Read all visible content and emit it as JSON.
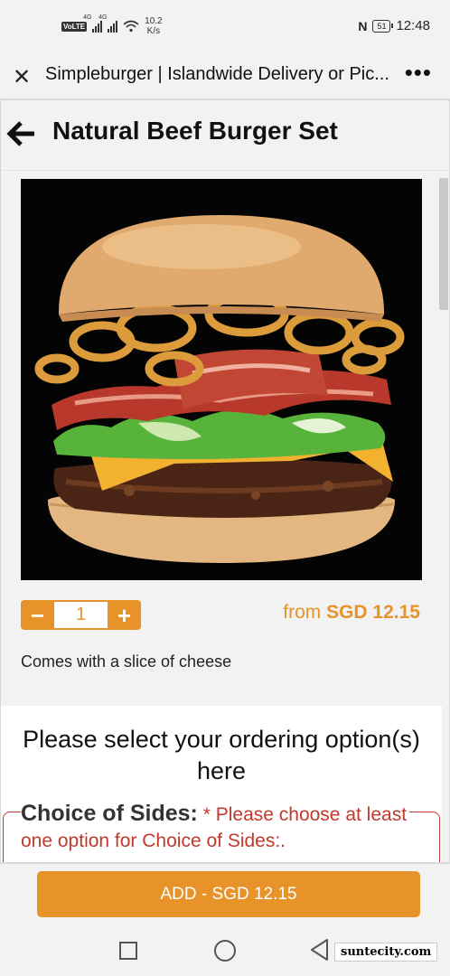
{
  "status_bar": {
    "volte": "VoLTE",
    "network_1": "4G",
    "network_2": "4G",
    "speed_value": "10.2",
    "speed_unit": "K/s",
    "battery": "51",
    "time": "12:48"
  },
  "browser": {
    "title": "Simpleburger | Islandwide Delivery or Pic...",
    "close_icon": "close-icon",
    "more_icon": "more-vert-icon"
  },
  "page": {
    "title": "Natural Beef Burger Set",
    "back_icon": "arrow-left-icon"
  },
  "product": {
    "image": "burger-photo",
    "quantity": "1",
    "minus": "−",
    "plus": "+",
    "price_prefix": "from",
    "price_amount": "SGD 12.15",
    "description": "Comes with a slice of cheese"
  },
  "options": {
    "heading": "Please select your ordering option(s) here",
    "sides_label": "Choice of Sides:",
    "sides_error": "* Please choose at least one option for Choice of Sides:."
  },
  "footer": {
    "add_button": "ADD - SGD 12.15"
  },
  "nav": {
    "recents_icon": "square-icon",
    "home_icon": "circle-icon",
    "back_icon": "triangle-back-icon"
  },
  "watermark": "suntecity.com",
  "colors": {
    "accent": "#e8922a",
    "error": "#c0392b"
  }
}
